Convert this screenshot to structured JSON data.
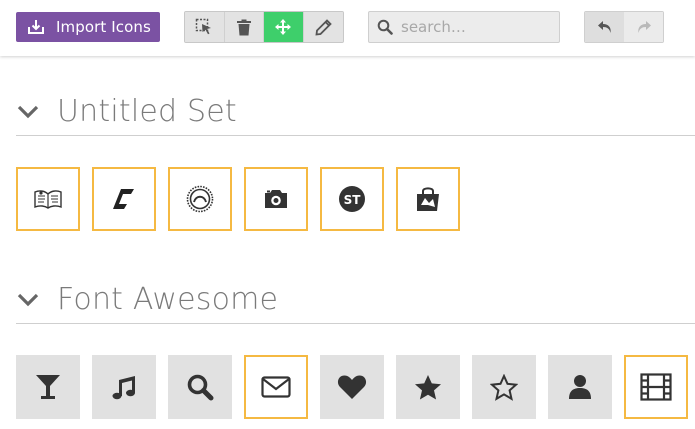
{
  "toolbar": {
    "import_label": "Import Icons",
    "tools": [
      "select-icon",
      "trash-icon",
      "move-icon",
      "pencil-icon"
    ],
    "active_tool": "move-icon",
    "search_placeholder": "search…",
    "search_value": ""
  },
  "sets": [
    {
      "title": "Untitled Set",
      "icons": [
        "book-icon",
        "stylized-c-icon",
        "circle-dial-icon",
        "camera-icon",
        "st-logo-icon",
        "shopping-bag-icon"
      ]
    },
    {
      "title": "Font Awesome",
      "icons": [
        "glass-icon",
        "music-icon",
        "search-icon",
        "envelope-icon",
        "heart-icon",
        "star-icon",
        "star-outline-icon",
        "user-icon",
        "film-icon"
      ],
      "selected": [
        "envelope-icon",
        "film-icon"
      ]
    }
  ],
  "colors": {
    "import_button": "#7b52a3",
    "active_tool": "#3ecf6b",
    "selected_border": "#f5b942",
    "tile_bg": "#e1e1e1"
  }
}
